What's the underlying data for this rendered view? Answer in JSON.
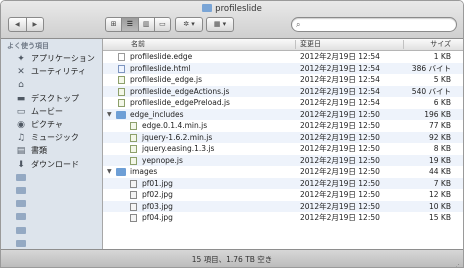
{
  "window": {
    "title": "profileslide"
  },
  "toolbar": {
    "back": "◀",
    "forward": "▶",
    "views": [
      "⊞",
      "☰",
      "▥",
      "▭"
    ],
    "action": "✲ ▾",
    "arrange": "▦ ▾",
    "search_placeholder": ""
  },
  "sidebar": {
    "header": "よく使う項目",
    "items": [
      {
        "label": "アプリケーション",
        "icon": "applications-icon"
      },
      {
        "label": "ユーティリティ",
        "icon": "utilities-icon"
      },
      {
        "label": "",
        "icon": "home-icon"
      },
      {
        "label": "デスクトップ",
        "icon": "desktop-icon"
      },
      {
        "label": "ムービー",
        "icon": "movies-icon"
      },
      {
        "label": "ピクチャ",
        "icon": "pictures-icon"
      },
      {
        "label": "ミュージック",
        "icon": "music-icon"
      },
      {
        "label": "書類",
        "icon": "documents-icon"
      },
      {
        "label": "ダウンロード",
        "icon": "downloads-icon"
      },
      {
        "label": "",
        "icon": "folder-icon"
      },
      {
        "label": "",
        "icon": "folder-icon"
      },
      {
        "label": "",
        "icon": "folder-icon"
      },
      {
        "label": "",
        "icon": "folder-icon"
      },
      {
        "label": "",
        "icon": "folder-icon"
      },
      {
        "label": "",
        "icon": "folder-icon"
      }
    ]
  },
  "columns": {
    "name": "名前",
    "date": "変更日",
    "size": "サイズ"
  },
  "files": [
    {
      "name": "profileslide.edge",
      "date": "2012年2月19日 12:54",
      "size": "1 KB",
      "level": 0,
      "kind": "file"
    },
    {
      "name": "profileslide.html",
      "date": "2012年2月19日 12:54",
      "size": "386 バイト",
      "level": 0,
      "kind": "html"
    },
    {
      "name": "profileslide_edge.js",
      "date": "2012年2月19日 12:54",
      "size": "5 KB",
      "level": 0,
      "kind": "js"
    },
    {
      "name": "profileslide_edgeActions.js",
      "date": "2012年2月19日 12:54",
      "size": "540 バイト",
      "level": 0,
      "kind": "js"
    },
    {
      "name": "profileslide_edgePreload.js",
      "date": "2012年2月19日 12:54",
      "size": "6 KB",
      "level": 0,
      "kind": "js"
    },
    {
      "name": "edge_includes",
      "date": "2012年2月19日 12:50",
      "size": "196 KB",
      "level": 0,
      "kind": "folder"
    },
    {
      "name": "edge.0.1.4.min.js",
      "date": "2012年2月19日 12:50",
      "size": "77 KB",
      "level": 1,
      "kind": "js"
    },
    {
      "name": "jquery-1.6.2.min.js",
      "date": "2012年2月19日 12:50",
      "size": "92 KB",
      "level": 1,
      "kind": "js"
    },
    {
      "name": "jquery.easing.1.3.js",
      "date": "2012年2月19日 12:50",
      "size": "8 KB",
      "level": 1,
      "kind": "js"
    },
    {
      "name": "yepnope.js",
      "date": "2012年2月19日 12:50",
      "size": "19 KB",
      "level": 1,
      "kind": "js"
    },
    {
      "name": "images",
      "date": "2012年2月19日 12:50",
      "size": "44 KB",
      "level": 0,
      "kind": "folder"
    },
    {
      "name": "pf01.jpg",
      "date": "2012年2月19日 12:50",
      "size": "7 KB",
      "level": 1,
      "kind": "img"
    },
    {
      "name": "pf02.jpg",
      "date": "2012年2月19日 12:50",
      "size": "12 KB",
      "level": 1,
      "kind": "img"
    },
    {
      "name": "pf03.jpg",
      "date": "2012年2月19日 12:50",
      "size": "10 KB",
      "level": 1,
      "kind": "img"
    },
    {
      "name": "pf04.jpg",
      "date": "2012年2月19日 12:50",
      "size": "15 KB",
      "level": 1,
      "kind": "img"
    }
  ],
  "status": {
    "text": "15 項目、1.76 TB 空き"
  }
}
